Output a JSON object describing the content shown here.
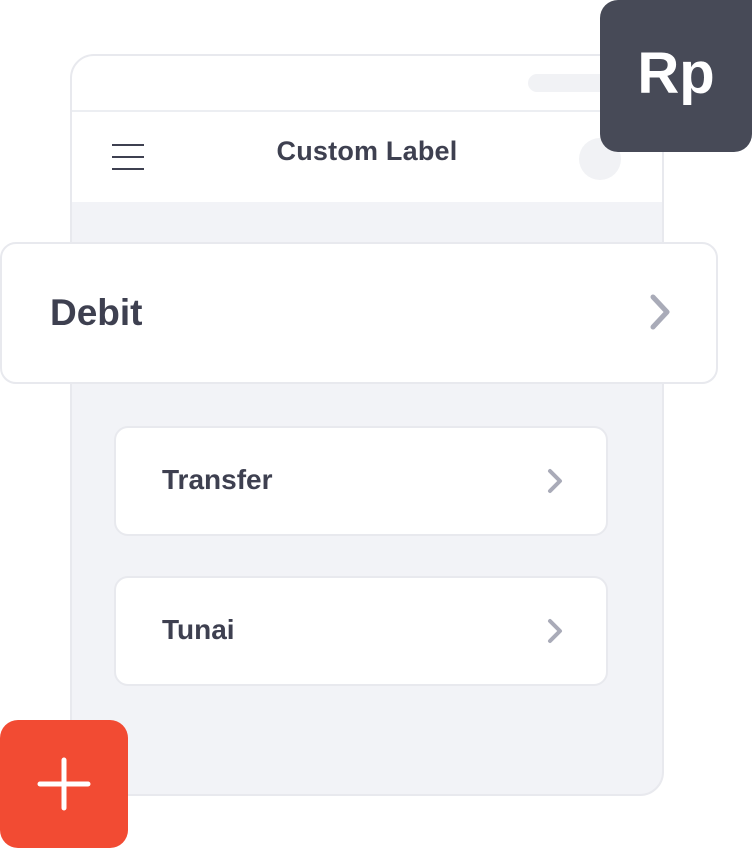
{
  "app_bar": {
    "title": "Custom Label",
    "menu_icon": "hamburger-icon"
  },
  "badge": {
    "text": "Rp",
    "color": "#474a57"
  },
  "debit": {
    "label": "Debit",
    "icon": "chevron-right-icon"
  },
  "items": [
    {
      "label": "Transfer",
      "icon": "chevron-right-icon"
    },
    {
      "label": "Tunai",
      "icon": "chevron-right-icon"
    }
  ],
  "fab": {
    "icon": "plus-icon",
    "color": "#f24b33"
  },
  "colors": {
    "text": "#3e4050",
    "chevron": "#a9abb8",
    "background": "#f2f3f7"
  }
}
